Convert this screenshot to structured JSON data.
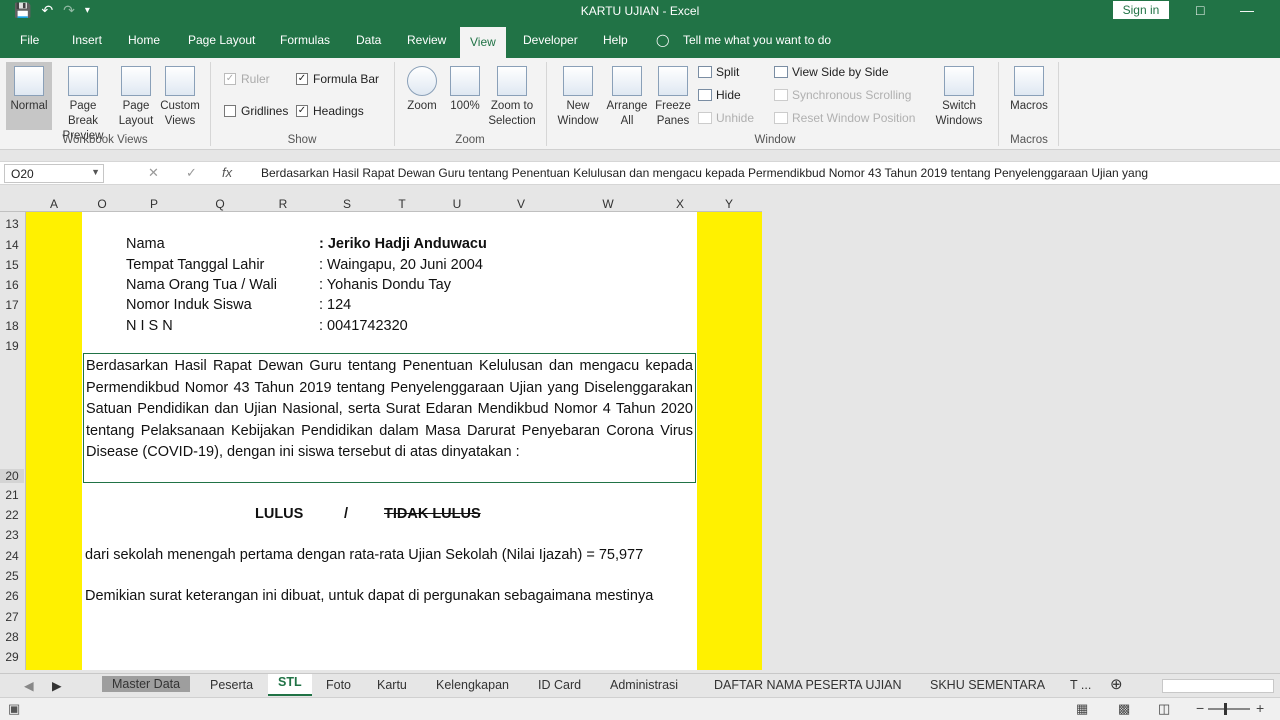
{
  "window": {
    "title": "KARTU UJIAN  -  Excel",
    "sign_in": "Sign in",
    "qat": [
      "save-icon",
      "undo-icon",
      "redo-icon",
      "customize-icon"
    ]
  },
  "tabs": [
    "File",
    "Insert",
    "Home",
    "Page Layout",
    "Formulas",
    "Data",
    "Review",
    "View",
    "Developer",
    "Help"
  ],
  "tell_me": "Tell me what you want to do",
  "ribbon": {
    "workbook_views": {
      "label": "Workbook Views",
      "normal": "Normal",
      "page_break": "Page Break Preview",
      "page_layout": "Page Layout",
      "custom_views": "Custom Views"
    },
    "show": {
      "label": "Show",
      "ruler": "Ruler",
      "formula_bar": "Formula Bar",
      "gridlines": "Gridlines",
      "headings": "Headings"
    },
    "zoom": {
      "label": "Zoom",
      "zoom": "Zoom",
      "hundred": "100%",
      "zoom_selection": "Zoom to Selection"
    },
    "window": {
      "label": "Window",
      "new_window": "New Window",
      "arrange_all": "Arrange All",
      "freeze_panes": "Freeze Panes",
      "split": "Split",
      "hide": "Hide",
      "unhide": "Unhide",
      "side_by_side": "View Side by Side",
      "sync_scroll": "Synchronous Scrolling",
      "reset_pos": "Reset Window Position",
      "switch_windows": "Switch Windows"
    },
    "macros": {
      "label": "Macros",
      "macros": "Macros"
    }
  },
  "formula_bar": {
    "name_box": "O20",
    "content": "Berdasarkan Hasil Rapat Dewan Guru  tentang Penentuan Kelulusan dan mengacu kepada Permendikbud Nomor 43 Tahun 2019 tentang Penyelenggaraan Ujian yang"
  },
  "columns": [
    "A",
    "O",
    "P",
    "Q",
    "R",
    "S",
    "T",
    "U",
    "V",
    "W",
    "X",
    "Y"
  ],
  "rows": [
    "13",
    "14",
    "15",
    "16",
    "17",
    "18",
    "19",
    "20",
    "21",
    "22",
    "23",
    "24",
    "25",
    "26",
    "27",
    "28",
    "29"
  ],
  "student": {
    "fields": [
      {
        "label": "Nama",
        "value": ": Jeriko Hadji Anduwacu"
      },
      {
        "label": "Tempat Tanggal Lahir",
        "value": ": Waingapu, 20 Juni 2004"
      },
      {
        "label": "Nama Orang Tua / Wali",
        "value": ": Yohanis Dondu Tay"
      },
      {
        "label": "Nomor Induk Siswa",
        "value": ": 124"
      },
      {
        "label": "N I S N",
        "value": ": 0041742320"
      }
    ]
  },
  "paragraph": "Berdasarkan Hasil Rapat Dewan Guru  tentang Penentuan Kelulusan dan mengacu kepada Permendikbud Nomor 43 Tahun 2019 tentang Penyelenggaraan Ujian yang Diselenggarakan Satuan Pendidikan dan Ujian Nasional, serta Surat Edaran Mendikbud Nomor 4 Tahun 2020 tentang Pelaksanaan Kebijakan Pendidikan dalam Masa Darurat Penyebaran Corona Virus Disease (COVID-19), dengan ini siswa tersebut di atas dinyatakan :",
  "result": {
    "lulus": "LULUS",
    "slash": "/",
    "tidak_lulus": "TIDAK LULUS"
  },
  "line24": "dari sekolah menengah pertama dengan rata-rata Ujian Sekolah (Nilai Ijazah) =  75,977",
  "line26": "Demikian surat keterangan ini dibuat, untuk dapat di pergunakan sebagaimana mestinya",
  "sheets": [
    "Master Data",
    "Peserta",
    "STL",
    "Foto",
    "Kartu",
    "Kelengkapan",
    "ID Card",
    "Administrasi",
    "DAFTAR NAMA PESERTA UJIAN",
    "SKHU SEMENTARA",
    "T ..."
  ],
  "colors": {
    "excel_green": "#217346",
    "yellow": "#fff100"
  }
}
